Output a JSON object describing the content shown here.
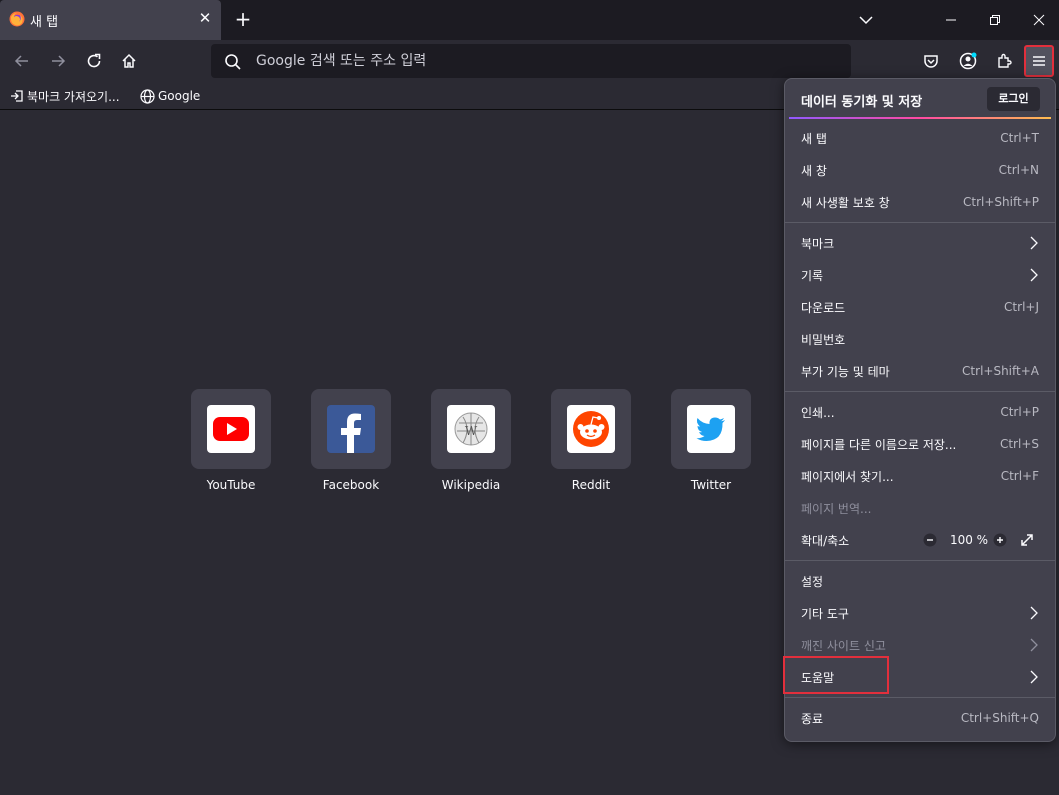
{
  "tab": {
    "title": "새 탭",
    "close": "✕"
  },
  "new_tab": "+",
  "url": {
    "placeholder": "Google 검색 또는 주소 입력"
  },
  "bookmarks": [
    {
      "label": "북마크 가져오기...",
      "icon": "import-icon"
    },
    {
      "label": "Google",
      "icon": "globe-icon"
    }
  ],
  "top_sites": [
    {
      "label": "YouTube",
      "icon": "youtube-logo"
    },
    {
      "label": "Facebook",
      "icon": "facebook-logo"
    },
    {
      "label": "Wikipedia",
      "icon": "wikipedia-logo"
    },
    {
      "label": "Reddit",
      "icon": "reddit-logo"
    },
    {
      "label": "Twitter",
      "icon": "twitter-logo"
    }
  ],
  "menu": {
    "header": {
      "title": "데이터 동기화 및 저장",
      "login": "로그인"
    },
    "groups": [
      [
        {
          "label": "새 탭",
          "shortcut": "Ctrl+T"
        },
        {
          "label": "새 창",
          "shortcut": "Ctrl+N"
        },
        {
          "label": "새 사생활 보호 창",
          "shortcut": "Ctrl+Shift+P"
        }
      ],
      [
        {
          "label": "북마크",
          "arrow": true
        },
        {
          "label": "기록",
          "arrow": true
        },
        {
          "label": "다운로드",
          "shortcut": "Ctrl+J"
        },
        {
          "label": "비밀번호"
        },
        {
          "label": "부가 기능 및 테마",
          "shortcut": "Ctrl+Shift+A"
        }
      ],
      [
        {
          "label": "인쇄...",
          "shortcut": "Ctrl+P"
        },
        {
          "label": "페이지를 다른 이름으로 저장...",
          "shortcut": "Ctrl+S"
        },
        {
          "label": "페이지에서 찾기...",
          "shortcut": "Ctrl+F"
        },
        {
          "label": "페이지 번역...",
          "disabled": true
        },
        {
          "label": "확대/축소",
          "zoom": "100 %"
        }
      ],
      [
        {
          "label": "설정"
        },
        {
          "label": "기타 도구",
          "arrow": true
        },
        {
          "label": "깨진 사이트 신고",
          "arrow": true,
          "disabled": true
        },
        {
          "label": "도움말",
          "arrow": true
        }
      ],
      [
        {
          "label": "종료",
          "shortcut": "Ctrl+Shift+Q"
        }
      ]
    ]
  },
  "colors": {
    "accent": "#e22f3c",
    "panel": "#42414d",
    "background": "#2b2a33",
    "frame": "#1c1b22"
  }
}
